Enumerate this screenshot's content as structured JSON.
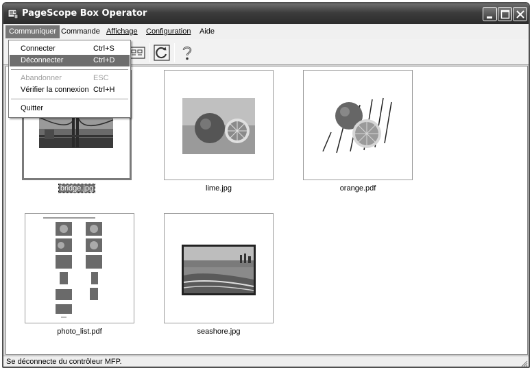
{
  "window": {
    "title": "PageScope Box Operator",
    "controls": [
      "minimize-icon",
      "maximize-icon",
      "close-icon"
    ]
  },
  "menubar": {
    "items": [
      {
        "label": "Communiquer",
        "active": true
      },
      {
        "label": "Commande",
        "active": false
      },
      {
        "label": "Affichage",
        "active": false
      },
      {
        "label": "Configuration",
        "active": false
      },
      {
        "label": "Aide",
        "active": false
      }
    ]
  },
  "dropdown": {
    "items": [
      {
        "label": "Connecter",
        "shortcut": "Ctrl+S",
        "state": "normal"
      },
      {
        "label": "Déconnecter",
        "shortcut": "Ctrl+D",
        "state": "highlighted"
      },
      {
        "label": "Abandonner",
        "shortcut": "ESC",
        "state": "disabled"
      },
      {
        "label": "Vérifier la connexion",
        "shortcut": "Ctrl+H",
        "state": "normal"
      },
      {
        "label": "Quitter",
        "shortcut": "",
        "state": "normal"
      }
    ]
  },
  "toolbar": {
    "icons": [
      "view-icon",
      "refresh-icon",
      "help-icon"
    ]
  },
  "files": [
    {
      "name": "bridge.jpg",
      "selected": true
    },
    {
      "name": "lime.jpg",
      "selected": false
    },
    {
      "name": "orange.pdf",
      "selected": false
    },
    {
      "name": "photo_list.pdf",
      "selected": false
    },
    {
      "name": "seashore.jpg",
      "selected": false
    }
  ],
  "status": {
    "text": "Se déconnecte du contrôleur MFP."
  }
}
